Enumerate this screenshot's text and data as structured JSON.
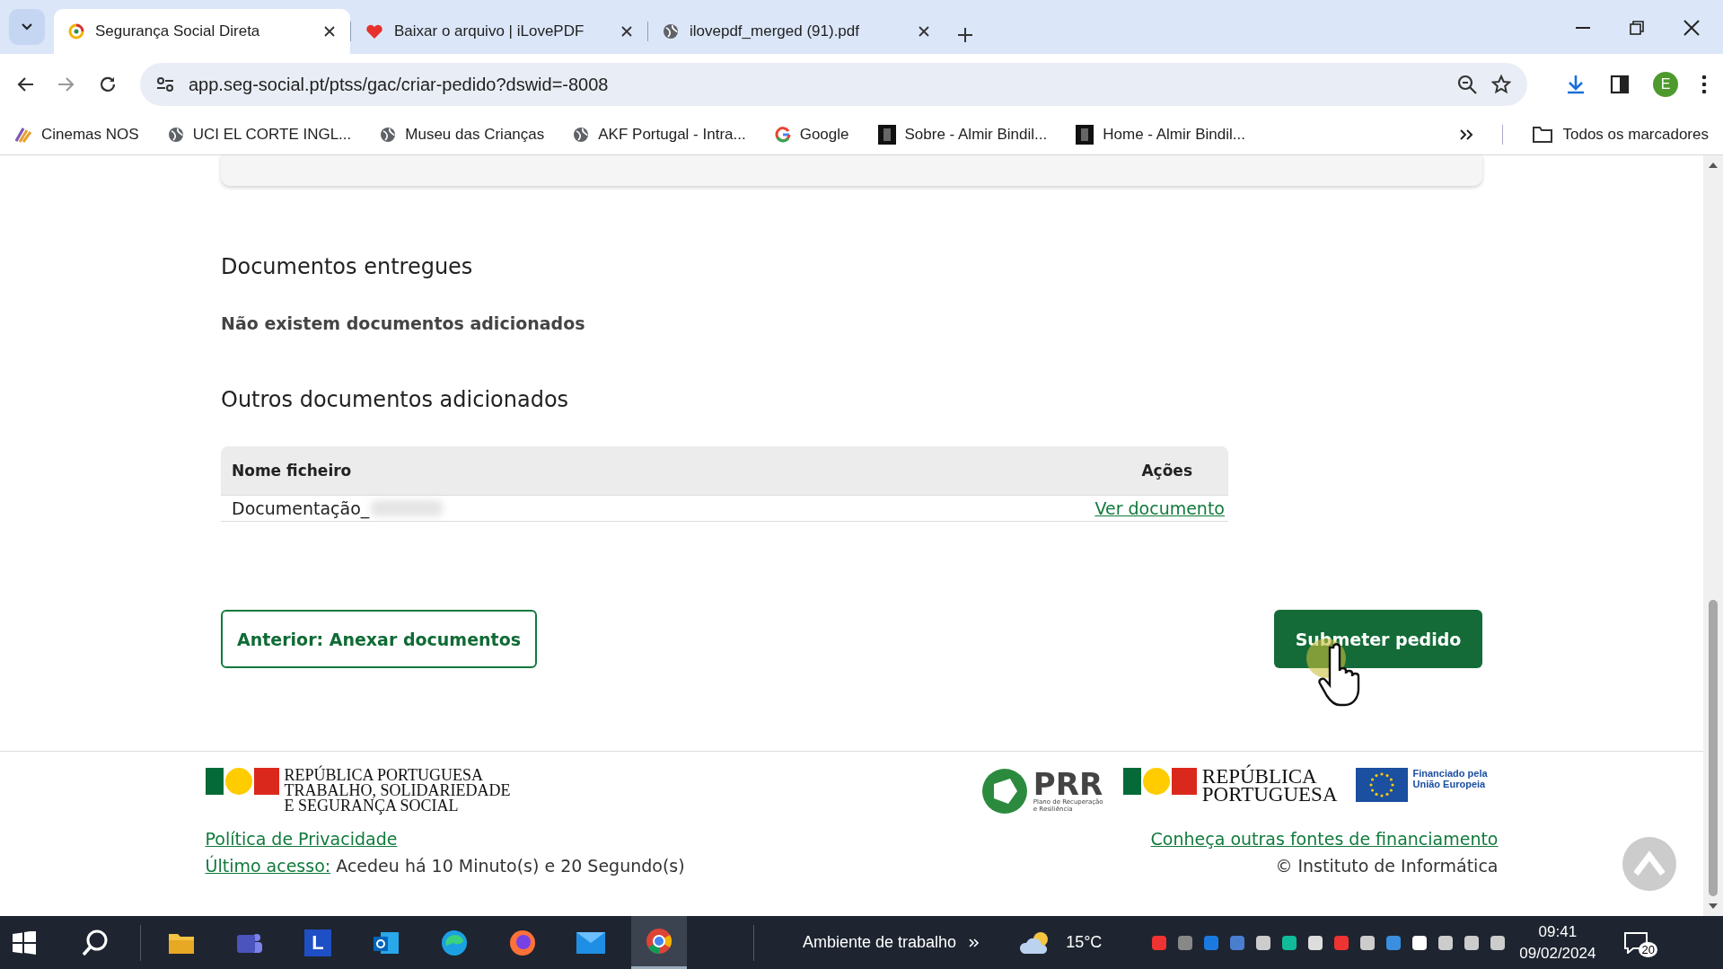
{
  "browser": {
    "tabs": [
      {
        "title": "Segurança Social Direta",
        "selected": true
      },
      {
        "title": "Baixar o arquivo | iLovePDF",
        "selected": false
      },
      {
        "title": "ilovepdf_merged (91).pdf",
        "selected": false
      }
    ],
    "address": "app.seg-social.pt/ptss/gac/criar-pedido?dswid=-8008",
    "profile_initial": "E",
    "bookmarks": [
      "Cinemas NOS",
      "UCI EL CORTE INGL...",
      "Museu das Crianças",
      "AKF Portugal - Intra...",
      "Google",
      "Sobre - Almir Bindil...",
      "Home - Almir Bindil..."
    ],
    "bookmarks_folder": "Todos os marcadores"
  },
  "page": {
    "sections": [
      {
        "heading": "Documentos entregues",
        "empty_message": "Não existem documentos adicionados"
      },
      {
        "heading": "Outros documentos adicionados",
        "table": {
          "columns": [
            "Nome ficheiro",
            "Ações"
          ],
          "rows": [
            {
              "file_name": "Documentação_",
              "action": "Ver documento"
            }
          ]
        }
      }
    ],
    "back_button": "Anterior: Anexar documentos",
    "submit_button": "Submeter pedido"
  },
  "footer": {
    "left_logo": [
      "REPÚBLICA PORTUGUESA",
      "TRABALHO, SOLIDARIEDADE",
      "E SEGURANÇA SOCIAL"
    ],
    "prr_logo": {
      "acronym": "PRR",
      "subtitle": "Plano de Recuperação e Resiliência"
    },
    "right_logo": [
      "REPÚBLICA",
      "PORTUGUESA"
    ],
    "eu_logo": "Financiado pela União Europeia",
    "privacy_link": "Política de Privacidade",
    "last_access_link": "Último acesso:",
    "last_access_text": "Acedeu há 10 Minuto(s) e 20 Segundo(s)",
    "funding_link": "Conheça outras fontes de financiamento",
    "copyright": "© Instituto de Informática"
  },
  "taskbar": {
    "apps": [
      {
        "kind": "files",
        "selected": false
      },
      {
        "kind": "teams",
        "selected": false
      },
      {
        "kind": "letter",
        "label": "L",
        "selected": false
      },
      {
        "kind": "outlook",
        "selected": false
      },
      {
        "kind": "edge",
        "selected": false
      },
      {
        "kind": "firefox",
        "selected": false
      },
      {
        "kind": "mail",
        "selected": false
      },
      {
        "kind": "chrome",
        "selected": true
      }
    ],
    "desktop_label": "Ambiente de trabalho",
    "temperature": "15°C",
    "time": "09:41",
    "date": "09/02/2024",
    "notifications": "20"
  }
}
